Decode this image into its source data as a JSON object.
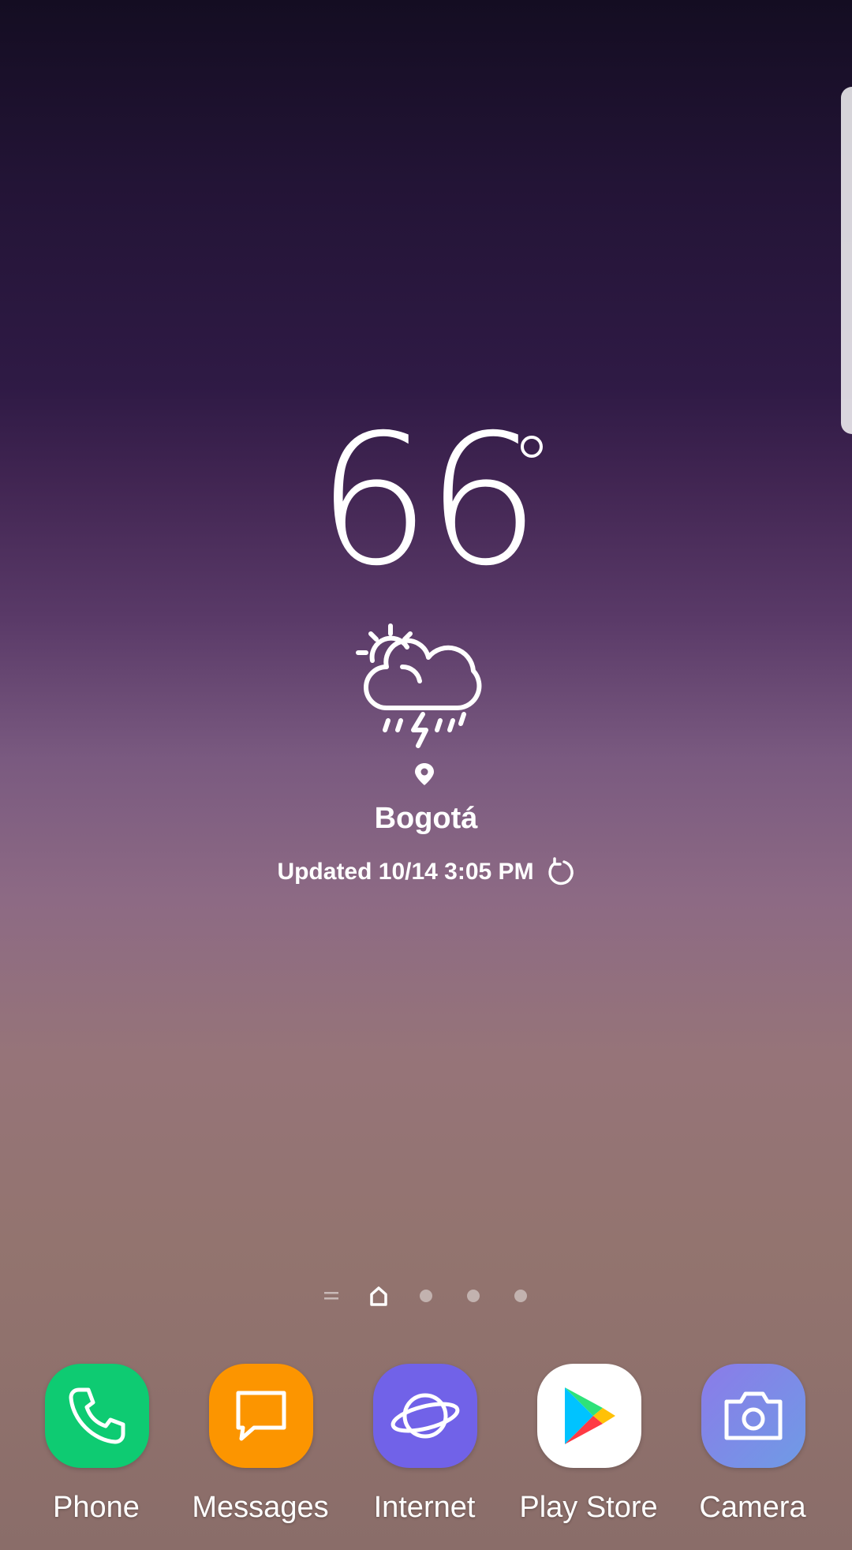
{
  "weather": {
    "temperature": "66",
    "condition_icon": "partly-sunny-thunderstorm-icon",
    "city": "Bogotá",
    "updated": "Updated 10/14 3:05 PM"
  },
  "home": {
    "page_indicators": [
      "menu-lines-icon",
      "home-icon",
      "dot",
      "dot",
      "dot"
    ],
    "active_page": 1
  },
  "dock": {
    "apps": [
      {
        "label": "Phone",
        "icon": "phone-icon",
        "color": "#0ecb72"
      },
      {
        "label": "Messages",
        "icon": "messages-icon",
        "color": "#fc9500"
      },
      {
        "label": "Internet",
        "icon": "internet-planet-icon",
        "color": "#7162e8"
      },
      {
        "label": "Play Store",
        "icon": "play-store-icon",
        "color": "#ffffff"
      },
      {
        "label": "Camera",
        "icon": "camera-icon",
        "color": "#7a7fe8"
      }
    ]
  }
}
